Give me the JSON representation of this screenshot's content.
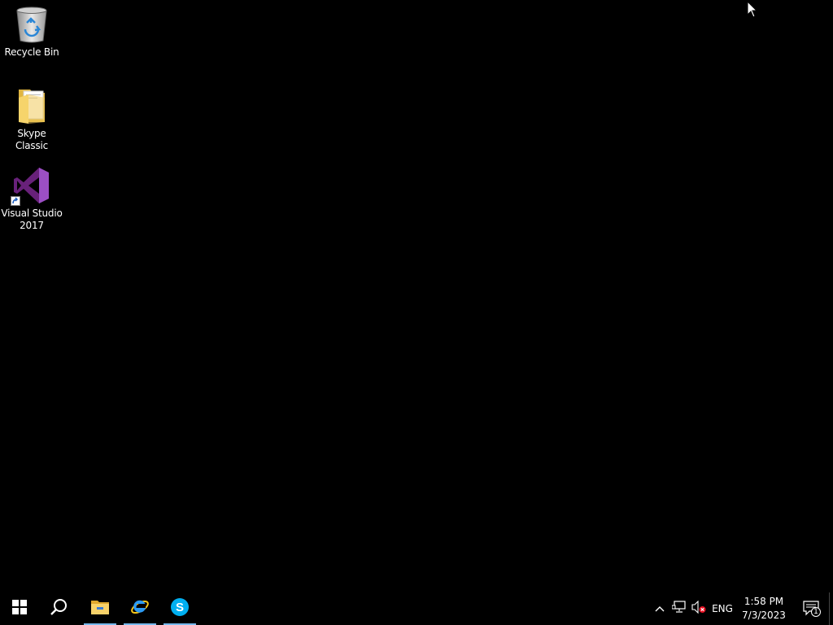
{
  "desktop": {
    "background_color": "#000000",
    "icons": [
      {
        "label": "Recycle Bin",
        "icon": "recycle-bin-icon"
      },
      {
        "label": "Skype Classic",
        "icon": "folder-icon"
      },
      {
        "label": "Visual Studio 2017",
        "icon": "visual-studio-icon"
      }
    ]
  },
  "taskbar": {
    "start": {
      "icon": "windows-logo-icon"
    },
    "search": {
      "icon": "search-icon"
    },
    "pinned_apps": [
      {
        "name": "File Explorer",
        "icon": "file-explorer-icon",
        "running": true
      },
      {
        "name": "Internet Explorer",
        "icon": "internet-explorer-icon",
        "running": true
      },
      {
        "name": "Skype",
        "icon": "skype-icon",
        "running": true
      }
    ],
    "tray": {
      "language": "ENG",
      "time": "1:58 PM",
      "date": "7/3/2023",
      "notification_count": "1"
    },
    "accent_color": "#76b9ed"
  }
}
